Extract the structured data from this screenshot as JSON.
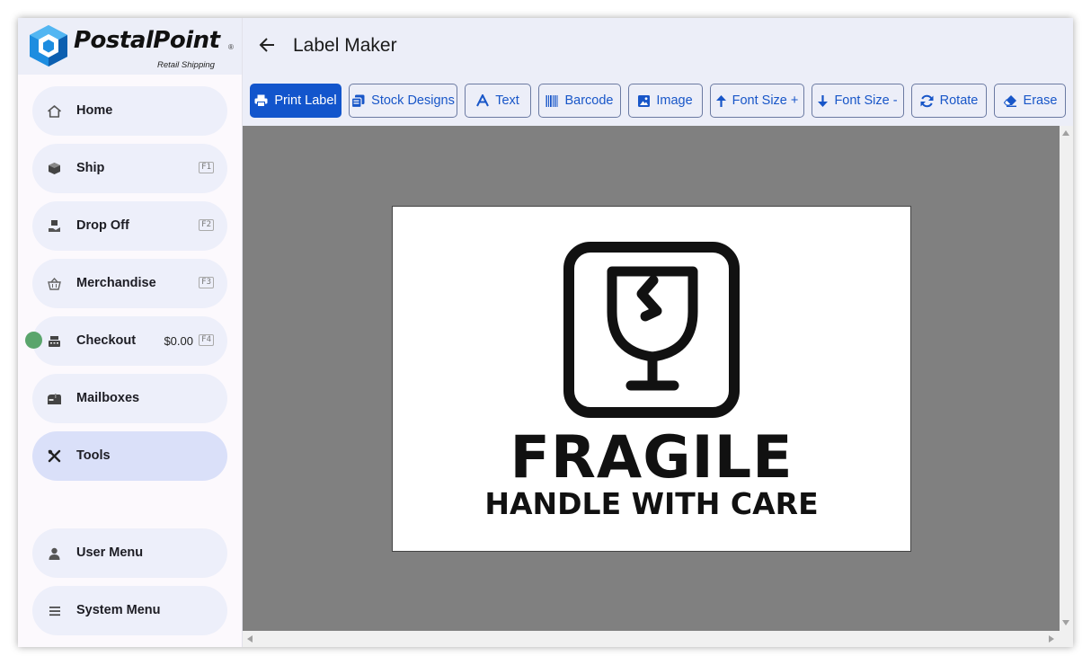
{
  "app": {
    "logo_text": "PostalPoint",
    "logo_reg": "®",
    "logo_subtitle": "Retail Shipping",
    "accent_color": "#1255cc"
  },
  "sidebar": {
    "items": [
      {
        "label": "Home",
        "icon": "home-icon"
      },
      {
        "label": "Ship",
        "key": "F1",
        "icon": "package-icon"
      },
      {
        "label": "Drop Off",
        "key": "F2",
        "icon": "hand-package-icon"
      },
      {
        "label": "Merchandise",
        "key": "F3",
        "icon": "basket-icon"
      },
      {
        "label": "Checkout",
        "amount": "$0.00",
        "key": "F4",
        "icon": "cash-register-icon"
      },
      {
        "label": "Mailboxes",
        "icon": "mailbox-icon"
      },
      {
        "label": "Tools",
        "icon": "tools-icon",
        "active": true
      },
      {
        "label": "User Menu",
        "icon": "user-icon"
      },
      {
        "label": "System Menu",
        "icon": "hamburger-icon"
      }
    ]
  },
  "header": {
    "title": "Label Maker",
    "back_icon": "arrow-left-icon"
  },
  "toolbar": {
    "print_label": "Print Label",
    "stock_designs": "Stock Designs",
    "text": "Text",
    "barcode": "Barcode",
    "image": "Image",
    "font_size_plus": "Font Size +",
    "font_size_minus": "Font Size -",
    "rotate": "Rotate",
    "erase": "Erase"
  },
  "label": {
    "title": "FRAGILE",
    "subtitle": "HANDLE WITH CARE",
    "icon": "fragile-glass-icon"
  }
}
